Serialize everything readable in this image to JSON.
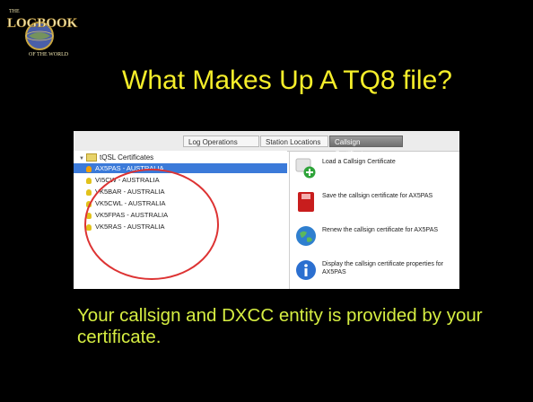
{
  "logo": {
    "line1": "THE",
    "line2": "LOGBOOK",
    "line3": "OF THE WORLD",
    "icon": "logbook-globe-logo"
  },
  "slide": {
    "title": "What Makes Up A TQ8 file?",
    "caption": "Your callsign and DXCC entity is provided by your certificate."
  },
  "tabs": [
    {
      "label": "Log Operations",
      "active": false
    },
    {
      "label": "Station Locations",
      "active": false
    },
    {
      "label": "Callsign Certificates",
      "active": true
    }
  ],
  "tree": {
    "root_label": "tQSL Certificates",
    "items": [
      {
        "label": "AX5PAS - AUSTRALIA",
        "selected": true
      },
      {
        "label": "VI5CW - AUSTRALIA",
        "selected": false
      },
      {
        "label": "VK5BAR - AUSTRALIA",
        "selected": false
      },
      {
        "label": "VK5CWL - AUSTRALIA",
        "selected": false
      },
      {
        "label": "VK5FPAS - AUSTRALIA",
        "selected": false
      },
      {
        "label": "VK5RAS - AUSTRALIA",
        "selected": false
      }
    ]
  },
  "actions": [
    {
      "label": "Load a Callsign Certificate",
      "icon": "load-certificate-icon"
    },
    {
      "label": "Save the callsign certificate for AX5PAS",
      "icon": "save-certificate-icon"
    },
    {
      "label": "Renew the callsign certificate for AX5PAS",
      "icon": "renew-globe-icon"
    },
    {
      "label": "Display the callsign certificate properties for AX5PAS",
      "icon": "info-icon"
    }
  ],
  "colors": {
    "title": "#f5ee2a",
    "caption": "#d6ee42",
    "selection": "#3b7ad9",
    "annotation_circle": "#dd3333"
  }
}
